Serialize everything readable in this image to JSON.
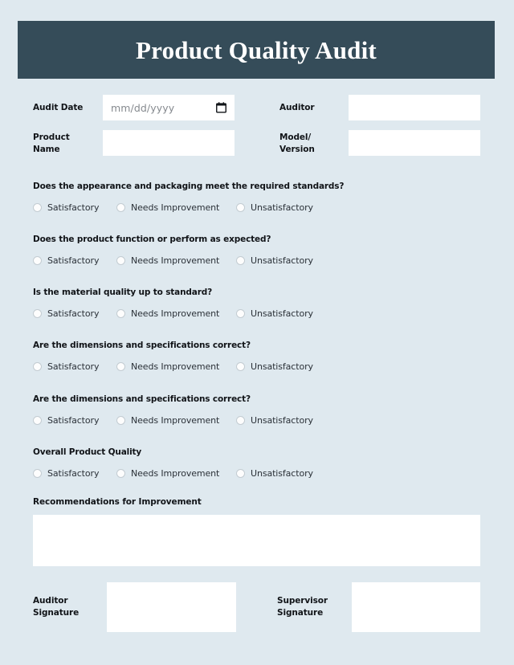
{
  "header": {
    "title": "Product Quality Audit",
    "background_color": "#354c59",
    "title_color": "#ffffff"
  },
  "theme": {
    "page_background": "#dfe9ef",
    "field_background": "#ffffff",
    "label_color": "#111418",
    "radio_border_color": "#c3ccd2"
  },
  "fields": {
    "audit_date": {
      "label": "Audit Date",
      "placeholder": "mm/dd/yyyy",
      "value": "",
      "icon": "calendar-icon"
    },
    "auditor": {
      "label": "Auditor",
      "placeholder": "",
      "value": ""
    },
    "product_name": {
      "label": "Product\nName",
      "placeholder": "",
      "value": ""
    },
    "model_version": {
      "label": "Model/\nVersion",
      "placeholder": "",
      "value": ""
    }
  },
  "radio_options": [
    "Satisfactory",
    "Needs Improvement",
    "Unsatisfactory"
  ],
  "questions": [
    {
      "id": "appearance",
      "label": "Does the appearance and packaging meet the required standards?",
      "selected": null
    },
    {
      "id": "function",
      "label": "Does the product function or perform as expected?",
      "selected": null
    },
    {
      "id": "material",
      "label": "Is the material quality up to standard?",
      "selected": null
    },
    {
      "id": "dimensions1",
      "label": "Are the dimensions and specifications correct?",
      "selected": null
    },
    {
      "id": "dimensions2",
      "label": "Are the dimensions and specifications correct?",
      "selected": null
    },
    {
      "id": "overall",
      "label": "Overall Product Quality",
      "selected": null
    }
  ],
  "recommendations": {
    "label": "Recommendations for Improvement",
    "placeholder": "",
    "value": ""
  },
  "signatures": {
    "auditor": {
      "label": "Auditor\nSignature",
      "value": ""
    },
    "supervisor": {
      "label": "Supervisor\nSignature",
      "value": ""
    }
  }
}
